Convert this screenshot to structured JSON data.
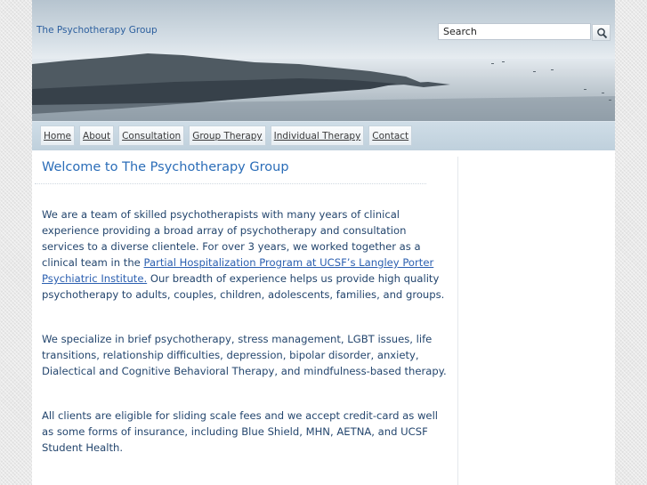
{
  "header": {
    "site_title": "The Psychotherapy Group",
    "search": {
      "value": "Search"
    },
    "icons": {
      "search_button": "magnifier-icon"
    }
  },
  "nav": {
    "items": [
      {
        "label": "Home"
      },
      {
        "label": "About"
      },
      {
        "label": "Consultation"
      },
      {
        "label": "Group Therapy"
      },
      {
        "label": "Individual Therapy"
      },
      {
        "label": "Contact"
      }
    ]
  },
  "main": {
    "title": "Welcome to The Psychotherapy Group",
    "paragraph1": {
      "before_link": "We are a team of skilled psychotherapists with many years of clinical experience providing a broad array of psychotherapy and consultation services to a diverse clientele. For over 3 years, we worked together as a clinical team in the ",
      "link": "Partial Hospitalization Program at UCSF’s Langley Porter Psychiatric Institute.",
      "after_link": " Our breadth of experience helps us provide high quality psychotherapy to adults, couples, children, adolescents, families, and groups."
    },
    "paragraph2": "We specialize in brief psychotherapy, stress management, LGBT issues, life transitions, relationship difficulties, depression, bipolar disorder, anxiety, Dialectical and Cognitive Behavioral Therapy, and mindfulness-based therapy.",
    "paragraph3": "All clients are eligible for sliding scale fees and we accept credit-card as well as some forms of insurance, including Blue Shield, MHN, AETNA, and UCSF Student Health."
  },
  "colors": {
    "title_blue": "#2b6db8",
    "body_text": "#24466e",
    "nav_bar": "#c8d7e2"
  }
}
